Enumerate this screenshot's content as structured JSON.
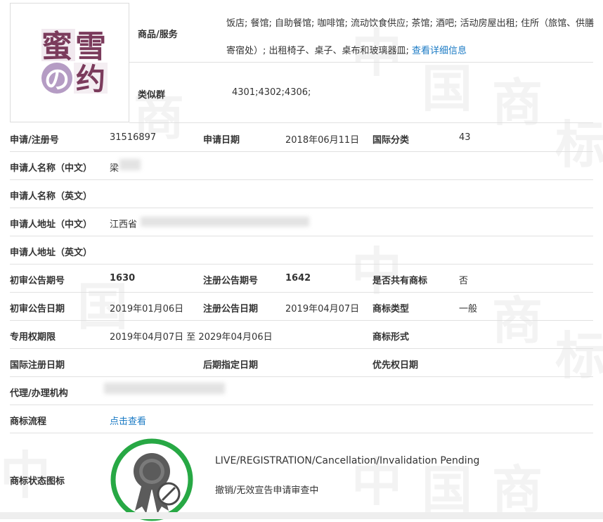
{
  "logo": {
    "chars": [
      "蜜",
      "雪",
      "の",
      "约"
    ]
  },
  "goods_services": {
    "label": "商品/服务",
    "text": "饭店; 餐馆; 自助餐馆; 咖啡馆; 流动饮食供应; 茶馆; 酒吧; 活动房屋出租; 住所（旅馆、供膳寄宿处）; 出租椅子、桌子、桌布和玻璃器皿;",
    "link": "查看详细信息"
  },
  "similar_group": {
    "label": "类似群",
    "value": "4301;4302;4306;"
  },
  "reg_no": {
    "label": "申请/注册号",
    "value": "31516897"
  },
  "app_date": {
    "label": "申请日期",
    "value": "2018年06月11日"
  },
  "intl_class": {
    "label": "国际分类",
    "value": "43"
  },
  "applicant_cn": {
    "label": "申请人名称（中文）",
    "value": "梁"
  },
  "applicant_en": {
    "label": "申请人名称（英文）",
    "value": ""
  },
  "address_cn": {
    "label": "申请人地址（中文）",
    "value": "江西省"
  },
  "address_en": {
    "label": "申请人地址（英文）",
    "value": ""
  },
  "prelim_issue": {
    "label": "初审公告期号",
    "value": "1630"
  },
  "reg_issue": {
    "label": "注册公告期号",
    "value": "1642"
  },
  "shared": {
    "label": "是否共有商标",
    "value": "否"
  },
  "prelim_date": {
    "label": "初审公告日期",
    "value": "2019年01月06日"
  },
  "reg_date": {
    "label": "注册公告日期",
    "value": "2019年04月07日"
  },
  "mark_type": {
    "label": "商标类型",
    "value": "一般"
  },
  "exclusive_period": {
    "label": "专用权期限",
    "value": "2019年04月07日 至 2029年04月06日"
  },
  "mark_form": {
    "label": "商标形式",
    "value": ""
  },
  "intl_reg_date": {
    "label": "国际注册日期",
    "value": ""
  },
  "later_designation": {
    "label": "后期指定日期",
    "value": ""
  },
  "priority_date": {
    "label": "优先权日期",
    "value": ""
  },
  "agent": {
    "label": "代理/办理机构",
    "value": ""
  },
  "process": {
    "label": "商标流程",
    "link": "点击查看"
  },
  "status": {
    "label": "商标状态图标",
    "en": "LIVE/REGISTRATION/Cancellation/Invalidation Pending",
    "cn": "撤销/无效宣告申请审查中"
  },
  "colors": {
    "link": "#1a7ac4",
    "badge_ring": "#27a844",
    "badge_gray": "#5b5b5b",
    "logo_text": "#7b3b5c"
  },
  "watermark_chars": [
    "中",
    "国",
    "商",
    "标"
  ]
}
